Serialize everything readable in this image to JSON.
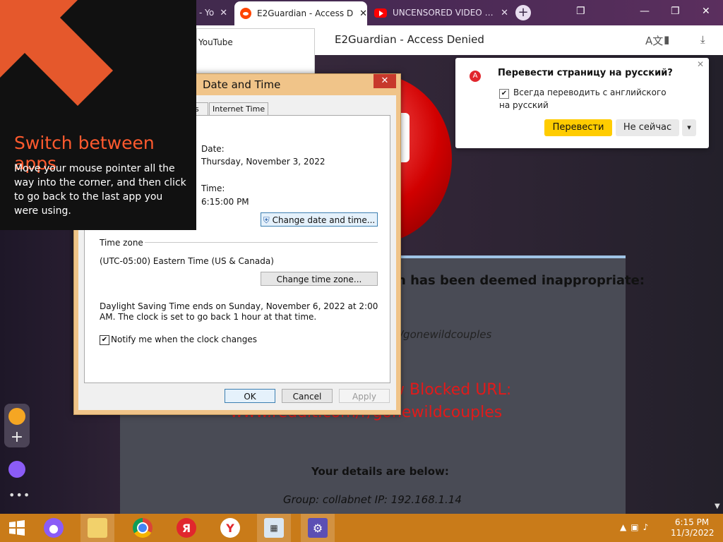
{
  "browser": {
    "tabs": [
      {
        "label": "- Yo",
        "active": false
      },
      {
        "label": "E2Guardian - Access D",
        "active": true
      },
      {
        "label": "UNCENSORED VIDEO (He",
        "active": false
      }
    ],
    "omnibar_title": "E2Guardian - Access Denied"
  },
  "youtube_popup": {
    "title": "YouTube"
  },
  "switch_apps": {
    "title": "Switch between apps",
    "description": "Move your mouse pointer all the way into the corner, and then click to go back to the last app you were using."
  },
  "translate_popup": {
    "title": "Перевести страницу на русский?",
    "checkbox_label": "Всегда переводить с английского на русский",
    "translate_button": "Перевести",
    "not_now_button": "Не сейчас"
  },
  "date_time_dialog": {
    "title": "Date and Time",
    "tab_partial": "s",
    "tab_internet_time": "Internet Time",
    "date_label": "Date:",
    "date_value": "Thursday, November 3, 2022",
    "time_label": "Time:",
    "time_value": "6:15:00 PM",
    "change_date_button": "Change date and time...",
    "time_zone_heading": "Time zone",
    "time_zone_value": "(UTC-05:00) Eastern Time (US & Canada)",
    "change_zone_button": "Change time zone...",
    "dst_text": "Daylight Saving Time ends on Sunday, November 6, 2022 at 2:00 AM. The clock is set to go back 1 hour at that time.",
    "notify_label": "Notify me when the clock changes",
    "ok": "OK",
    "cancel": "Cancel",
    "apply": "Apply"
  },
  "blocked_page": {
    "heading": "h has been deemed inappropriate:",
    "category": "/gonewildcouples",
    "blocked_label": "w  Blocked URL:",
    "url": "www.reddit.com/r/gonewildcouples",
    "details_heading": "Your details are below:",
    "group_ip": "Group: collabnet   IP: 192.168.1.14"
  },
  "taskbar": {
    "clock_time": "6:15 PM",
    "clock_date": "11/3/2022"
  },
  "colors": {
    "taskbar": "#c97b19",
    "accent_orange": "#ff5a2e",
    "yandex_yellow": "#ffcc00",
    "blocked_red": "#e21a1a"
  }
}
